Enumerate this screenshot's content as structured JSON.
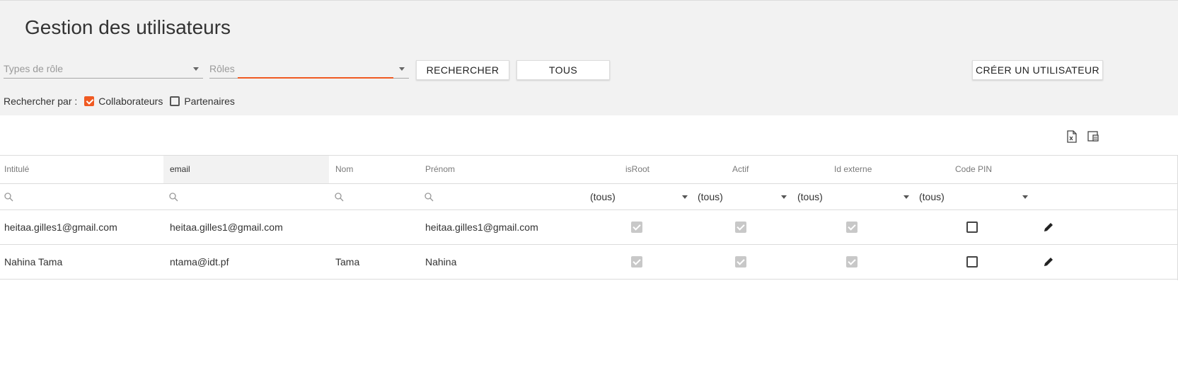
{
  "page": {
    "title": "Gestion des utilisateurs"
  },
  "filters": {
    "role_types_placeholder": "Types de rôle",
    "roles_placeholder": "Rôles",
    "search_button": "RECHERCHER",
    "all_button": "TOUS",
    "create_button": "CRÉER UN UTILISATEUR",
    "search_by_label": "Rechercher par :",
    "collaborators": {
      "label": "Collaborateurs",
      "checked": true
    },
    "partners": {
      "label": "Partenaires",
      "checked": false
    },
    "accent_color": "#f05a22"
  },
  "toolbar": {
    "icons": [
      "export-excel-icon",
      "column-chooser-icon"
    ]
  },
  "grid": {
    "columns": [
      "Intitulé",
      "email",
      "Nom",
      "Prénom",
      "isRoot",
      "Actif",
      "Id externe",
      "Code PIN"
    ],
    "sorted_column": "email",
    "filter_all": "(tous)",
    "rows": [
      {
        "intitule": "heitaa.gilles1@gmail.com",
        "email": "heitaa.gilles1@gmail.com",
        "nom": "",
        "prenom": "heitaa.gilles1@gmail.com",
        "isRoot": true,
        "actif": true,
        "id_externe": true,
        "code_pin": false
      },
      {
        "intitule": "Nahina Tama",
        "email": "ntama@idt.pf",
        "nom": "Tama",
        "prenom": "Nahina",
        "isRoot": true,
        "actif": true,
        "id_externe": true,
        "code_pin": false
      }
    ]
  }
}
